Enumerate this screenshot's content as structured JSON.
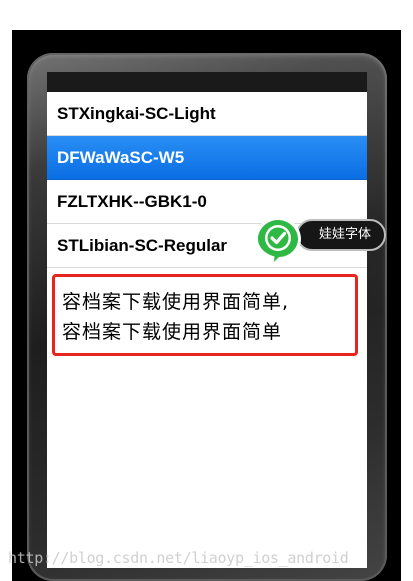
{
  "font_list": {
    "items": [
      {
        "label": "STXingkai-SC-Light",
        "selected": false
      },
      {
        "label": "DFWaWaSC-W5",
        "selected": true
      },
      {
        "label": "FZLTXHK--GBK1-0",
        "selected": false
      },
      {
        "label": "STLibian-SC-Regular",
        "selected": false
      }
    ]
  },
  "preview": {
    "line1": "容档案下载使用界面简单,",
    "line2": "容档案下载使用界面简单"
  },
  "tooltip": {
    "label": "娃娃字体"
  },
  "watermark": {
    "text": "http://blog.csdn.net/liaoyp_ios_android"
  },
  "colors": {
    "selection": "#0a6ee4",
    "highlight_border": "#e8241f",
    "badge_green": "#2fb844"
  },
  "icons": {
    "badge": "checkmark-icon"
  }
}
